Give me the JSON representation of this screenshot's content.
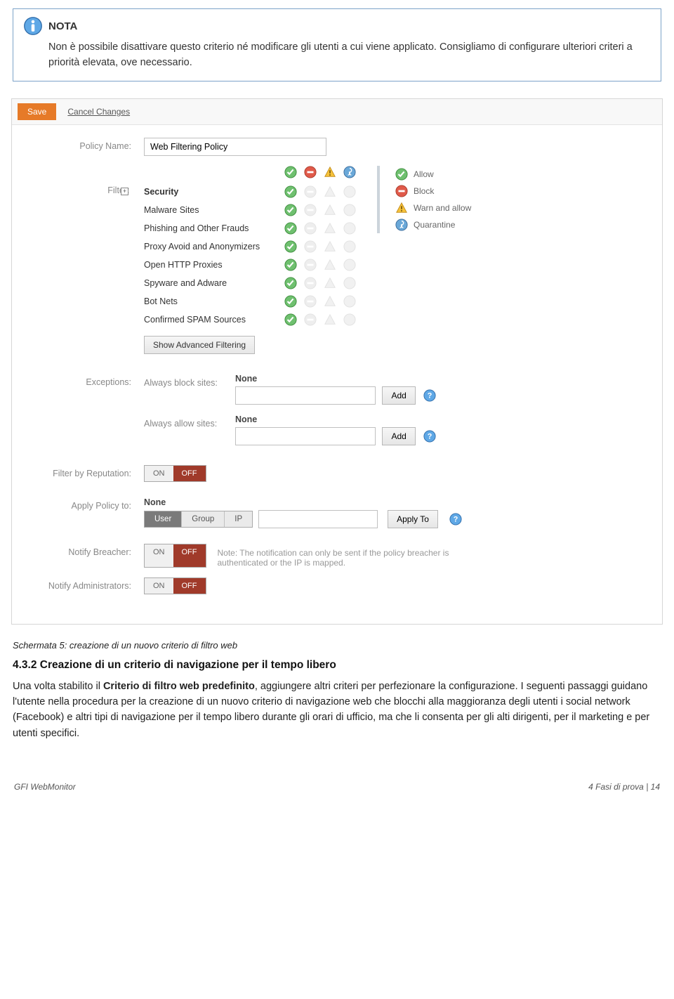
{
  "note": {
    "title": "NOTA",
    "body": "Non è possibile disattivare questo criterio né modificare gli utenti a cui viene applicato. Consigliamo di configurare ulteriori criteri a priorità elevata, ove necessario."
  },
  "toolbar": {
    "save": "Save",
    "cancel": "Cancel Changes"
  },
  "labels": {
    "policyName": "Policy Name:",
    "filter": "Filter:",
    "exceptions": "Exceptions:",
    "alwaysBlock": "Always block sites:",
    "alwaysAllow": "Always allow sites:",
    "filterByReputation": "Filter by Reputation:",
    "applyPolicyTo": "Apply Policy to:",
    "notifyBreacher": "Notify Breacher:",
    "notifyAdmins": "Notify Administrators:",
    "none": "None",
    "add": "Add",
    "applyTo": "Apply To",
    "on": "ON",
    "off": "OFF",
    "user": "User",
    "group": "Group",
    "ip": "IP",
    "showAdvanced": "Show Advanced Filtering",
    "breacherNote": "Note: The notification can only be sent if the policy breacher is authenticated or the IP is mapped."
  },
  "policyName": "Web Filtering Policy",
  "filterCategories": [
    "Security",
    "Malware Sites",
    "Phishing and Other Frauds",
    "Proxy Avoid and Anonymizers",
    "Open HTTP Proxies",
    "Spyware and Adware",
    "Bot Nets",
    "Confirmed SPAM Sources"
  ],
  "legend": {
    "allow": "Allow",
    "block": "Block",
    "warn": "Warn and allow",
    "quarantine": "Quarantine"
  },
  "caption": "Schermata 5: creazione di un nuovo criterio di filtro web",
  "section": {
    "title": "4.3.2 Creazione di un criterio di navigazione per il tempo libero",
    "p1a": "Una volta stabilito il ",
    "p1b": "Criterio di filtro web predefinito",
    "p1c": ", aggiungere altri criteri per perfezionare la configurazione. I seguenti passaggi guidano l'utente nella procedura per la creazione di un nuovo criterio di navigazione web che blocchi alla maggioranza degli utenti i social network (Facebook) e altri tipi di navigazione per il tempo libero durante gli orari di ufficio, ma che li consenta per gli alti dirigenti, per il marketing e per utenti specifici."
  },
  "footer": {
    "left": "GFI WebMonitor",
    "right": "4 Fasi di prova | 14"
  }
}
